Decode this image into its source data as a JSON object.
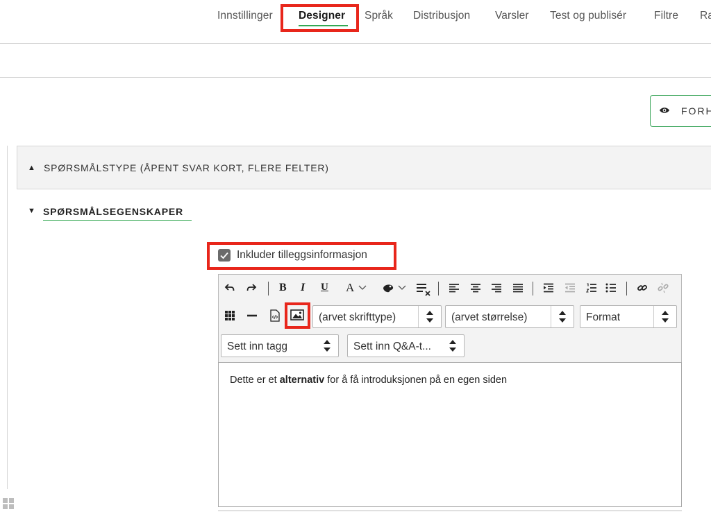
{
  "nav": {
    "items": [
      "Innstillinger",
      "Designer",
      "Språk",
      "Distribusjon",
      "Varsler",
      "Test og publisér",
      "Filtre",
      "Ra"
    ],
    "active_index": 1
  },
  "preview_button": {
    "label": "FORH",
    "icon": "eye-icon"
  },
  "sections": {
    "question_type": {
      "label": "SPØRSMÅLSTYPE (ÅPENT SVAR KORT, FLERE FELTER)",
      "state": "collapsed"
    },
    "question_properties": {
      "label": "SPØRSMÅLSEGENSKAPER",
      "state": "expanded"
    }
  },
  "checkbox": {
    "label": "Inkluder tilleggsinformasjon",
    "checked": true
  },
  "editor": {
    "toolbar_row1_icons": [
      "undo-icon",
      "redo-icon",
      "bold-icon",
      "italic-icon",
      "underline-icon",
      "text-color-icon",
      "background-color-icon",
      "remove-format-icon",
      "align-left-icon",
      "align-center-icon",
      "align-right-icon",
      "align-justify-icon",
      "indent-icon",
      "outdent-icon",
      "numbered-list-icon",
      "bullet-list-icon",
      "link-icon",
      "unlink-icon"
    ],
    "toolbar_glyphs": {
      "bold": "B",
      "italic": "I",
      "underline": "U",
      "text_color": "A"
    },
    "toolbar_row2_icons": [
      "table-icon",
      "horizontal-rule-icon",
      "source-icon",
      "image-icon"
    ],
    "font_select": "(arvet skrifttype)",
    "size_select": "(arvet størrelse)",
    "format_select": "Format",
    "tag_select": "Sett inn tagg",
    "qa_select": "Sett inn Q&A-t...",
    "content": {
      "before": "Dette er et ",
      "bold": "alternativ",
      "after": " for å få introduksjonen på en egen siden"
    }
  },
  "colors": {
    "accent_green": "#34a853",
    "highlight_red": "#e8261b"
  }
}
